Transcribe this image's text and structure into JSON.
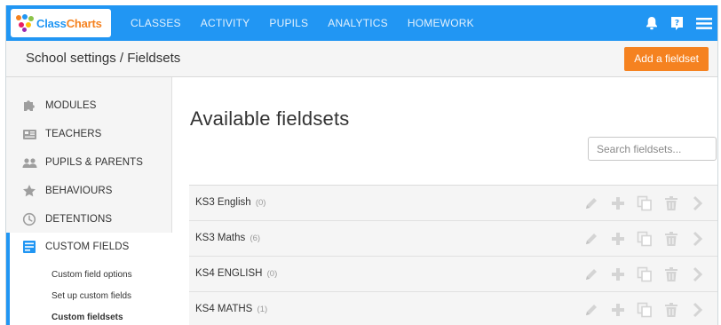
{
  "app": {
    "logo_part1": "Class",
    "logo_part2": "Charts",
    "accent_color": "#2196f3",
    "button_color": "#f58220"
  },
  "nav": {
    "items": [
      "CLASSES",
      "ACTIVITY",
      "PUPILS",
      "ANALYTICS",
      "HOMEWORK"
    ],
    "icons": [
      "bell-icon",
      "help-icon",
      "menu-icon"
    ]
  },
  "header": {
    "breadcrumb": "School settings / Fieldsets",
    "add_button": "Add a fieldset"
  },
  "sidebar": {
    "items": [
      {
        "label": "MODULES",
        "icon": "puzzle-icon"
      },
      {
        "label": "TEACHERS",
        "icon": "teachers-icon"
      },
      {
        "label": "PUPILS & PARENTS",
        "icon": "people-icon"
      },
      {
        "label": "BEHAVIOURS",
        "icon": "star-icon"
      },
      {
        "label": "DETENTIONS",
        "icon": "clock-icon"
      },
      {
        "label": "CUSTOM FIELDS",
        "icon": "custom-fields-icon",
        "active": true
      }
    ],
    "sub_items": [
      {
        "label": "Custom field options"
      },
      {
        "label": "Set up custom fields"
      },
      {
        "label": "Custom fieldsets",
        "current": true
      }
    ]
  },
  "main": {
    "title": "Available fieldsets",
    "search_placeholder": "Search fieldsets...",
    "rows": [
      {
        "name": "KS3 English",
        "count": "(0)"
      },
      {
        "name": "KS3 Maths",
        "count": "(6)"
      },
      {
        "name": "KS4 ENGLISH",
        "count": "(0)"
      },
      {
        "name": "KS4 MATHS",
        "count": "(1)"
      }
    ],
    "row_actions": [
      "edit-icon",
      "add-icon",
      "copy-icon",
      "delete-icon",
      "chevron-right-icon"
    ],
    "action_icon_color": "#d4d4d4"
  }
}
